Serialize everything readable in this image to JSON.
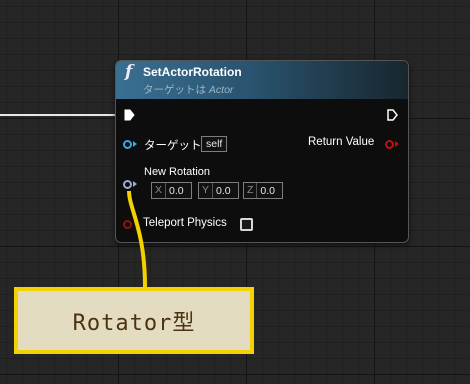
{
  "node": {
    "icon": "function-icon",
    "icon_glyph": "f",
    "title": "SetActorRotation",
    "subtitle_prefix": "ターゲットは",
    "subtitle_target": "Actor",
    "header_color": "#3a6f93"
  },
  "pins": {
    "target_label": "ターゲット",
    "target_value": "self",
    "return_label": "Return Value",
    "rotation_label": "New Rotation",
    "rotation": {
      "x_axis": "X",
      "x": "0.0",
      "y_axis": "Y",
      "y": "0.0",
      "z_axis": "Z",
      "z": "0.0"
    },
    "teleport_label": "Teleport Physics",
    "teleport_checked": false
  },
  "colors": {
    "target_pin": "#34a8e8",
    "return_pin": "#c01010",
    "rotator_pin": "#9da9d6",
    "bool_pin": "#9a0f0f",
    "callout_border": "#f4d200"
  },
  "callout": {
    "text": "Rotator型"
  }
}
